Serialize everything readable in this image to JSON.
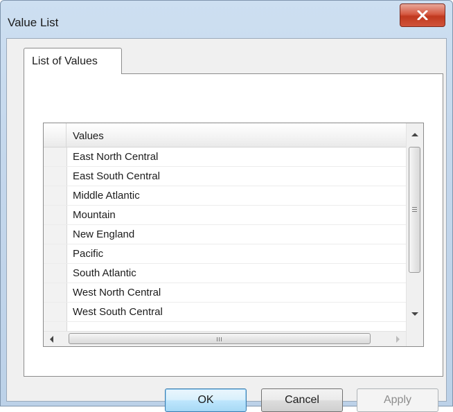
{
  "window": {
    "title": "Value List",
    "close_icon": "close-icon"
  },
  "tabs": [
    {
      "label": "List of Values",
      "selected": true
    }
  ],
  "list": {
    "column_header": "Values",
    "rows": [
      "East North Central",
      "East South Central",
      "Middle Atlantic",
      "Mountain",
      "New England",
      "Pacific",
      "South Atlantic",
      "West North Central",
      "West South Central"
    ]
  },
  "buttons": {
    "ok": "OK",
    "cancel": "Cancel",
    "apply": "Apply"
  },
  "colors": {
    "close_button": "#c9452c",
    "dialog_frame": "#c4d7ec",
    "default_button_border": "#3c7fb1"
  }
}
